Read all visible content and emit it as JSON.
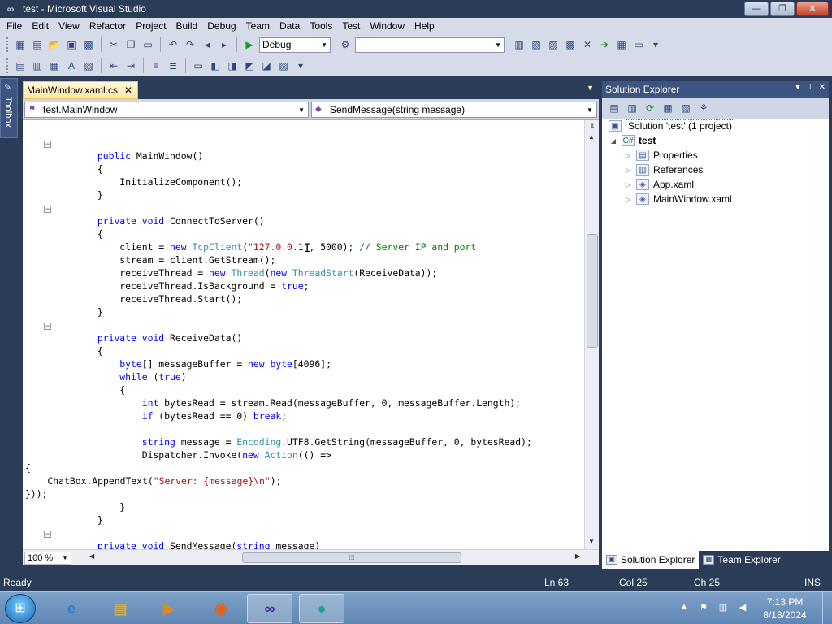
{
  "window": {
    "title": "test - Microsoft Visual Studio",
    "minimize": "—",
    "maximize": "❐",
    "close": "✕"
  },
  "menu": [
    "File",
    "Edit",
    "View",
    "Refactor",
    "Project",
    "Build",
    "Debug",
    "Team",
    "Data",
    "Tools",
    "Test",
    "Window",
    "Help"
  ],
  "toolbar": {
    "config": "Debug",
    "platform": ""
  },
  "toolbox": {
    "label": "Toolbox"
  },
  "editor": {
    "tab": "MainWindow.xaml.cs",
    "class_combo": "test.MainWindow",
    "member_combo": "SendMessage(string message)",
    "zoom": "100 %",
    "lines": [
      "",
      "        public MainWindow()",
      "        {",
      "            InitializeComponent();",
      "        }",
      "",
      "        private void ConnectToServer()",
      "        {",
      "            client = new TcpClient(\"127.0.0.1\", 5000); // Server IP and port",
      "            stream = client.GetStream();",
      "            receiveThread = new Thread(new ThreadStart(ReceiveData));",
      "            receiveThread.IsBackground = true;",
      "            receiveThread.Start();",
      "        }",
      "",
      "        private void ReceiveData()",
      "        {",
      "            byte[] messageBuffer = new byte[4096];",
      "            while (true)",
      "            {",
      "                int bytesRead = stream.Read(messageBuffer, 0, messageBuffer.Length);",
      "                if (bytesRead == 0) break;",
      "",
      "                string message = Encoding.UTF8.GetString(messageBuffer, 0, bytesRead);",
      "                Dispatcher.Invoke(new Action(() =>",
      "{",
      "    ChatBox.AppendText(\"Server: {message}\\n\");",
      "}));",
      "            }",
      "        }",
      "",
      "        private void SendMessage(string message)",
      "        {"
    ]
  },
  "solution_explorer": {
    "title": "Solution Explorer",
    "solution": "Solution 'test' (1 project)",
    "project": "test",
    "items": [
      "Properties",
      "References",
      "App.xaml",
      "MainWindow.xaml"
    ],
    "tabs": [
      "Solution Explorer",
      "Team Explorer"
    ]
  },
  "status": {
    "text": "Ready",
    "line": "Ln 63",
    "col": "Col 25",
    "ch": "Ch 25",
    "mode": "INS"
  },
  "taskbar": {
    "time": "7:13 PM",
    "date": "8/18/2024"
  }
}
